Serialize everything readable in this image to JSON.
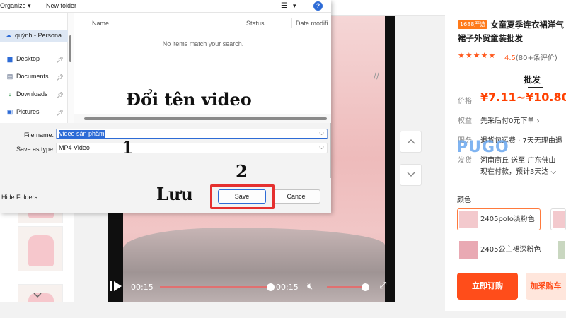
{
  "dialog": {
    "toolbar": {
      "organize": "Organize",
      "new_folder": "New folder",
      "help": "?"
    },
    "nav": {
      "cloud_item": "quỳnh - Persona",
      "items": [
        {
          "label": "Desktop",
          "icon": "desktop-icon"
        },
        {
          "label": "Documents",
          "icon": "documents-icon"
        },
        {
          "label": "Downloads",
          "icon": "downloads-icon"
        },
        {
          "label": "Pictures",
          "icon": "pictures-icon"
        }
      ]
    },
    "columns": [
      "Name",
      "Status",
      "Date modifi"
    ],
    "empty_message": "No items match your search.",
    "file_name_label": "File name:",
    "file_name_value": "video sản phẩm",
    "save_type_label": "Save as type:",
    "save_type_value": "MP4 Video",
    "hide_folders": "Hide Folders",
    "save_label": "Save",
    "cancel_label": "Cancel"
  },
  "annotations": {
    "rename": "Đổi tên video",
    "step1": "1",
    "step2": "2",
    "save_vi": "Lưu"
  },
  "video": {
    "current_time": "00:15",
    "duration": "00:15",
    "progress": 1.0,
    "volume": 0.9
  },
  "product": {
    "badge": "1688严选",
    "title": "女童夏季连衣裙洋气裙子外贸童装批发",
    "rating_value": "4.5",
    "rating_text": "(80+条评价)",
    "tab_wholesale": "批发",
    "price_label": "价格",
    "price": "¥7.11~¥10.80",
    "benefit_label": "权益",
    "benefit_text": "先采后付0元下单 ›",
    "service_label": "服务",
    "service_text": "退货包运费 · 7天无理由退",
    "ship_label": "发货",
    "ship_text": "河南商丘 送至 广东佛山",
    "ship_text2": "现在付款，预计3天达 ⌵",
    "watermark": "PUGO",
    "color_label": "颜色",
    "variants": [
      "2405polo淡粉色",
      "2405公主裙深粉色"
    ],
    "buy_now": "立即订购",
    "add_cart": "加采购车",
    "colors": {
      "accent": "#ff5a1f",
      "price": "#ff4000",
      "buy": "#ff4d1a",
      "cart": "#ffe6dc"
    }
  }
}
